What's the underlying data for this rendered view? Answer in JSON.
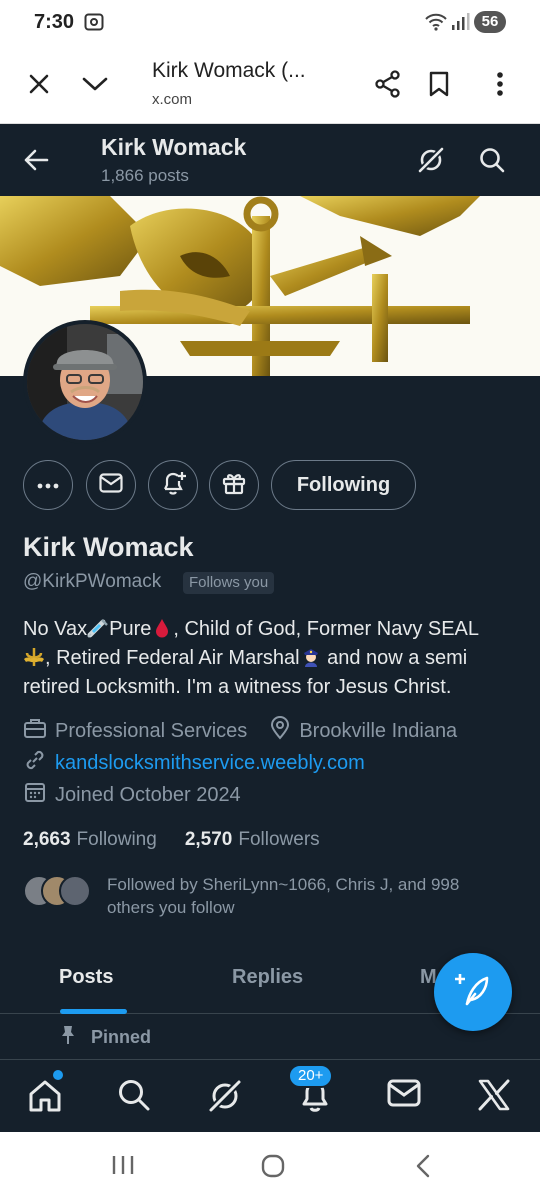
{
  "status_bar": {
    "time": "7:30",
    "battery": "56"
  },
  "browser": {
    "title": "Kirk Womack (...",
    "url": "x.com"
  },
  "header": {
    "name": "Kirk Womack",
    "post_count": "1,866 posts"
  },
  "profile": {
    "name": "Kirk Womack",
    "handle": "@KirkPWomack",
    "follows_you": "Follows you",
    "bio_line1_a": "No Vax",
    "bio_line1_b": "Pure",
    "bio_line1_c": ", Child of God, Former Navy SEAL",
    "bio_line2_a": ", Retired Federal Air Marshal",
    "bio_line2_b": " and now a semi",
    "bio_line3": "retired Locksmith.  I'm a witness for Jesus Christ.",
    "category": "Professional Services",
    "location": "Brookville Indiana",
    "website": "kandslocksmithservice.weebly.com",
    "joined": "Joined October 2024",
    "following_count": "2,663",
    "following_label": "Following",
    "followers_count": "2,570",
    "followers_label": "Followers",
    "followed_by_line1": "Followed by SheriLynn~1066, Chris J, and 998",
    "followed_by_line2": "others you follow",
    "following_button": "Following"
  },
  "tabs": [
    "Posts",
    "Replies",
    "M"
  ],
  "pinned_label": "Pinned",
  "bottom_nav": {
    "notifications_badge": "20+"
  },
  "colors": {
    "background": "#15202b",
    "accent": "#1d9bf0",
    "text": "#e7e9ea",
    "muted": "#8b98a5"
  }
}
